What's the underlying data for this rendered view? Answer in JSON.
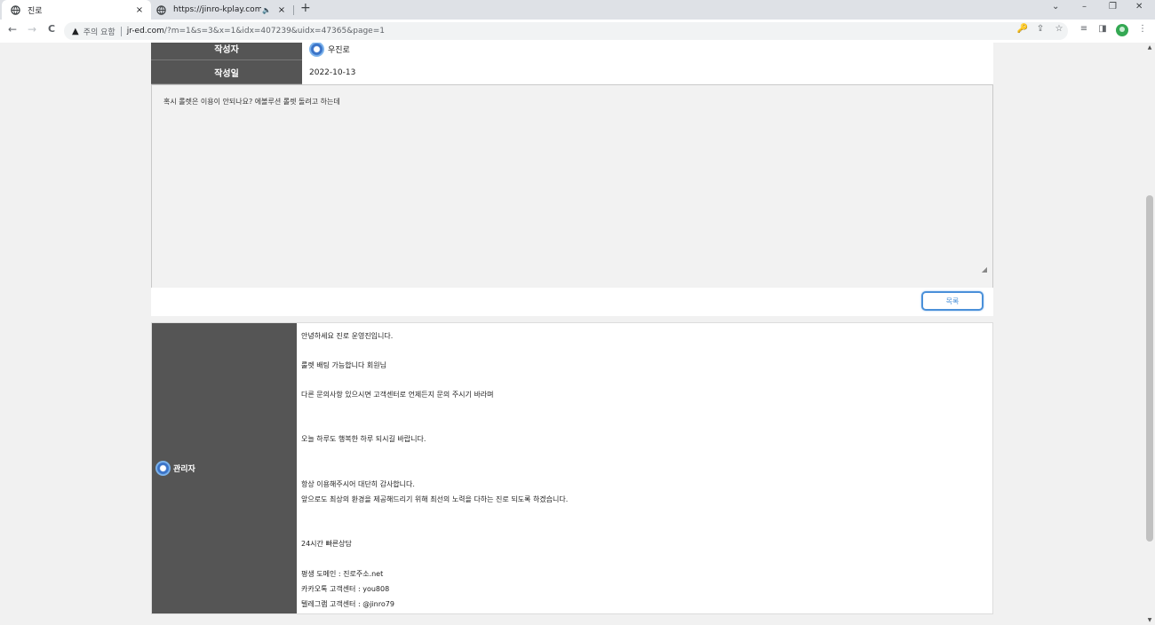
{
  "browser": {
    "tabs": [
      {
        "title": "진로",
        "close": "×"
      },
      {
        "title": "https://jinro-kplay.com",
        "audio": "🔈",
        "close": "×"
      }
    ],
    "new_tab": "+",
    "window_controls": {
      "dropdown": "⌄",
      "minimize": "–",
      "restore": "❐",
      "close": "✕"
    },
    "nav": {
      "back": "←",
      "forward": "→",
      "reload": "C"
    },
    "omnibox": {
      "warning_icon": "▲",
      "warning_text": "주의 요함",
      "domain": "jr-ed.com",
      "path": "/?m=1&s=3&x=1&idx=407239&uidx=47365&page=1"
    },
    "toolbar_icons": {
      "key": "🔑",
      "share": "⇪",
      "star": "☆",
      "reading_list": "≡",
      "sidepanel": "◨",
      "menu": "⋮"
    }
  },
  "post": {
    "author_label": "작성자",
    "author_name": "우진로",
    "date_label": "작성일",
    "date": "2022-10-13",
    "content": "혹시 롤렛은 이용이 안되나요? 에볼루션 롤렛 돌려고 하는데",
    "resize_grip": "◢",
    "list_button": "목록"
  },
  "reply": {
    "author": "관리자",
    "lines": [
      "안녕하세요 진로 운영진입니다.",
      "룰렛 배팅 가능합니다 회원님",
      "다른 문의사항 있으시면 고객센터로 언제든지 문의 주시기 바라며",
      "오늘 하루도 행복한 하루 되시길 바랍니다.",
      "항상 이용해주시어 대단히 감사합니다.",
      "앞으로도 최상의 환경을 제공해드리기 위해 최선의 노력을 다하는 진로 되도록 하겠습니다.",
      "24시간 빠른상담",
      "평생 도메인 : 진로주소.net",
      "카카오톡 고객센터 : you808",
      "텔레그램 고객센터 : @jinro79"
    ]
  },
  "scrollbar": {
    "up": "▲",
    "down": "▼"
  }
}
